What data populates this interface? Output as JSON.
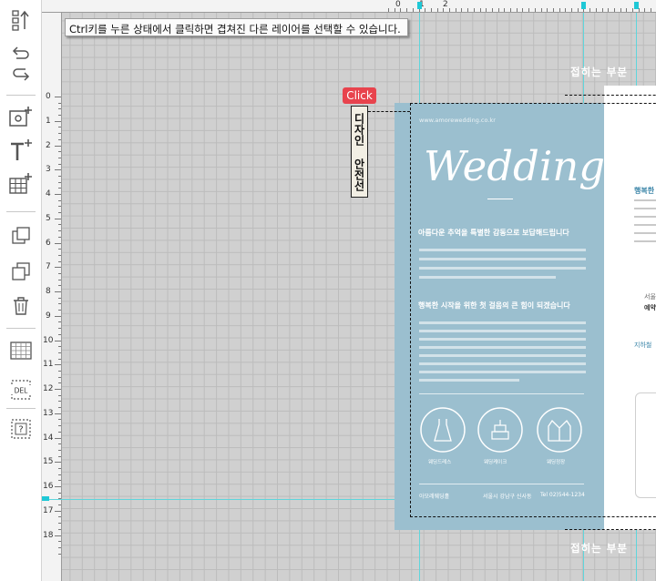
{
  "toolbar": {
    "tools": [
      {
        "icon": "sort-up-icon"
      },
      {
        "icon": "undo-icon"
      },
      {
        "icon": "redo-icon"
      },
      {
        "icon": "add-image-icon"
      },
      {
        "icon": "add-text-icon"
      },
      {
        "icon": "add-table-icon"
      },
      {
        "icon": "bring-forward-icon"
      },
      {
        "icon": "send-backward-icon"
      },
      {
        "icon": "trash-icon"
      },
      {
        "icon": "grid-icon"
      },
      {
        "icon": "delete-key-icon"
      },
      {
        "icon": "help-icon"
      }
    ],
    "del_label": "DEL",
    "help_label": "?"
  },
  "ruler": {
    "top_numbers": [
      "0",
      "1",
      "2"
    ],
    "left_numbers": [
      "0",
      "1",
      "2",
      "3",
      "4",
      "5",
      "6",
      "7",
      "8",
      "9",
      "10",
      "11",
      "12",
      "13",
      "14",
      "15",
      "16",
      "17",
      "18"
    ]
  },
  "tooltip": {
    "text": "Ctrl키를 누른 상태에서 클릭하면 겹쳐진 다른 레이어를 선택할 수 있습니다."
  },
  "fold": {
    "top_label": "접히는 부분",
    "bottom_label": "접히는 부분"
  },
  "annotation": {
    "click_badge": "Click",
    "vertical_tag": "디자인 안전선"
  },
  "design": {
    "url": "www.amorewedding.co.kr",
    "title": "Wedding",
    "heading1": "아름다운 추억을 특별한 감동으로 보답해드립니다",
    "heading2": "행복한 시작을 위한 첫 걸음의 큰 힘이 되겠습니다",
    "icon_labels": [
      "웨딩드레스",
      "웨딩케이크",
      "웨딩정장"
    ],
    "footer_left": "아모레웨딩홀",
    "footer_mid": "서울시 강남구 신사동",
    "footer_right": "Tel 02)544-1234",
    "right_heading": "행복한",
    "right_address": "서울",
    "right_reserve": "예약",
    "right_mini": "지하철"
  },
  "colors": {
    "canvas": "#d0d0d0",
    "grid": "#bcbcbc",
    "guide": "#5fd6dc",
    "panel_blue": "#9bbfcf",
    "click_red": "#e8434d"
  }
}
